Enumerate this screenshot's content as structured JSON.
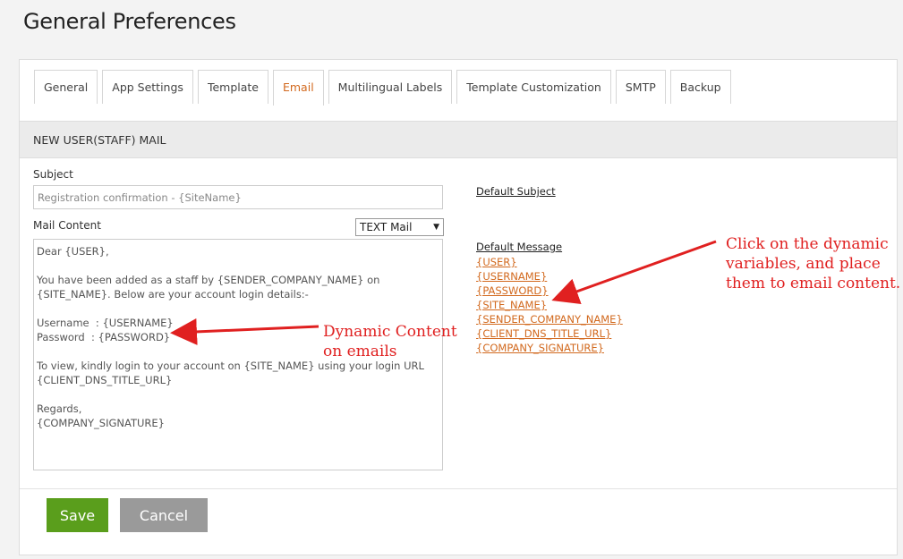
{
  "page": {
    "title": "General Preferences"
  },
  "tabs": [
    {
      "label": "General"
    },
    {
      "label": "App Settings"
    },
    {
      "label": "Template"
    },
    {
      "label": "Email",
      "active": true
    },
    {
      "label": "Multilingual Labels"
    },
    {
      "label": "Template Customization"
    },
    {
      "label": "SMTP"
    },
    {
      "label": "Backup"
    }
  ],
  "section": {
    "title": "NEW USER(STAFF) MAIL"
  },
  "form": {
    "subject_label": "Subject",
    "subject_value": "Registration confirmation - {SiteName}",
    "mail_content_label": "Mail Content",
    "mail_type_selected": "TEXT Mail",
    "mail_content": "Dear {USER},\n\nYou have been added as a staff by {SENDER_COMPANY_NAME} on\n{SITE_NAME}. Below are your account login details:-\n\nUsername  : {USERNAME}\nPassword  : {PASSWORD}\n\nTo view, kindly login to your account on {SITE_NAME} using your login URL\n{CLIENT_DNS_TITLE_URL}\n\nRegards,\n{COMPANY_SIGNATURE}"
  },
  "defaults": {
    "subject_link": "Default Subject",
    "message_link": "Default Message",
    "variables": [
      "{USER}",
      "{USERNAME}",
      "{PASSWORD}",
      "{SITE_NAME}",
      "{SENDER_COMPANY_NAME}",
      "{CLIENT_DNS_TITLE_URL}",
      "{COMPANY_SIGNATURE}"
    ]
  },
  "actions": {
    "save": "Save",
    "cancel": "Cancel"
  },
  "annotations": {
    "dynamic_content": "Dynamic Content\non emails",
    "click_vars": "Click on the dynamic\nvariables, and place\nthem to email content."
  },
  "colors": {
    "accent": "#d2691e",
    "save": "#5a9e1c",
    "cancel": "#9a9a9a",
    "annotation": "#e02020"
  }
}
